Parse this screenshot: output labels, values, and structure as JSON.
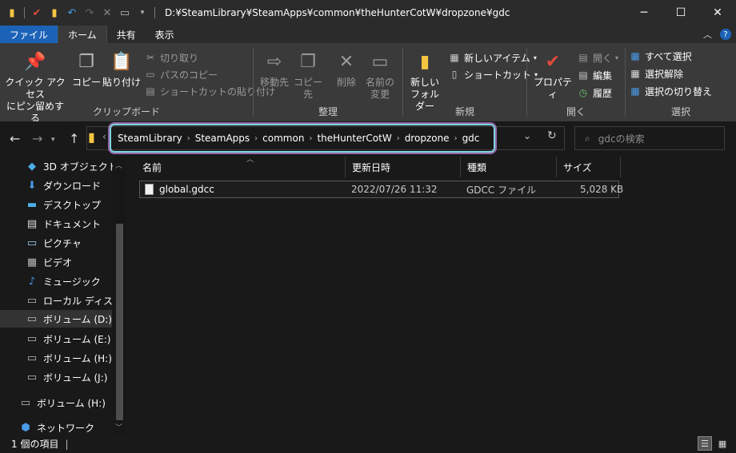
{
  "titlebar": {
    "path": "D:¥SteamLibrary¥SteamApps¥common¥theHunterCotW¥dropzone¥gdc",
    "minimize": "─",
    "maximize": "☐",
    "close": "✕"
  },
  "tabs": {
    "file": "ファイル",
    "home": "ホーム",
    "share": "共有",
    "view": "表示"
  },
  "ribbon": {
    "clipboard": {
      "label": "クリップボード",
      "pin": "クイック アクセス\nにピン留めする",
      "copy": "コピー",
      "paste": "貼り付け",
      "cut": "切り取り",
      "copy_path": "パスのコピー",
      "paste_shortcut": "ショートカットの貼り付け"
    },
    "organize": {
      "label": "整理",
      "move_to": "移動先",
      "copy_to": "コピー先",
      "delete": "削除",
      "rename": "名前の\n変更"
    },
    "new": {
      "label": "新規",
      "new_folder": "新しい\nフォルダー",
      "new_item": "新しいアイテム",
      "easy_access": "ショートカット"
    },
    "open": {
      "label": "開く",
      "properties": "プロパティ",
      "open": "開く",
      "edit": "編集",
      "history": "履歴"
    },
    "select": {
      "label": "選択",
      "select_all": "すべて選択",
      "select_none": "選択解除",
      "invert": "選択の切り替え"
    }
  },
  "address": {
    "crumbs": [
      "SteamLibrary",
      "SteamApps",
      "common",
      "theHunterCotW",
      "dropzone",
      "gdc"
    ],
    "search_placeholder": "gdcの検索"
  },
  "navpane": {
    "items": [
      {
        "label": "3D オブジェクト",
        "icon": "3d-objects-icon"
      },
      {
        "label": "ダウンロード",
        "icon": "download-icon"
      },
      {
        "label": "デスクトップ",
        "icon": "desktop-icon"
      },
      {
        "label": "ドキュメント",
        "icon": "documents-icon"
      },
      {
        "label": "ピクチャ",
        "icon": "pictures-icon"
      },
      {
        "label": "ビデオ",
        "icon": "video-icon"
      },
      {
        "label": "ミュージック",
        "icon": "music-icon"
      },
      {
        "label": "ローカル ディスク (C:)",
        "icon": "local-disk-icon"
      },
      {
        "label": "ボリューム (D:)",
        "icon": "drive-icon"
      },
      {
        "label": "ボリューム (E:)",
        "icon": "drive-icon"
      },
      {
        "label": "ボリューム (H:)",
        "icon": "drive-icon"
      },
      {
        "label": "ボリューム (J:)",
        "icon": "drive-icon"
      },
      {
        "label": "ボリューム (H:)",
        "icon": "drive-icon"
      },
      {
        "label": "ネットワーク",
        "icon": "network-icon"
      }
    ]
  },
  "filelist": {
    "columns": {
      "name": "名前",
      "modified": "更新日時",
      "type": "種類",
      "size": "サイズ"
    },
    "rows": [
      {
        "name": "global.gdcc",
        "modified": "2022/07/26 11:32",
        "type": "GDCC ファイル",
        "size": "5,028 KB"
      }
    ]
  },
  "status": {
    "count": "1 個の項目"
  }
}
